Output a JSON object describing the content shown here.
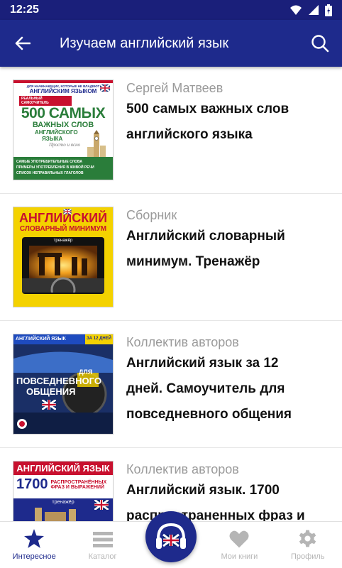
{
  "status_bar": {
    "time": "12:25"
  },
  "app_bar": {
    "title": "Изучаем английский язык"
  },
  "books": [
    {
      "author": "Сергей Матвеев",
      "title_lines": [
        "500 самых важных слов",
        "английского языка"
      ]
    },
    {
      "author": "Сборник",
      "title_lines": [
        "Английский словарный",
        "минимум. Тренажёр"
      ]
    },
    {
      "author": "Коллектив авторов",
      "title_lines": [
        "Английский язык за 12",
        "дней. Самоучитель для",
        "повседневного общения"
      ]
    },
    {
      "author": "Коллектив авторов",
      "title_lines": [
        "Английский язык. 1700",
        "распространенных фраз и"
      ]
    }
  ],
  "covers": {
    "cover1": {
      "top_text": "ДЛЯ НАЧИНАЮЩИХ, КОТОРЫЕ НЕ ВЛАДЕЮТ",
      "brand": "АНГЛИЙСКИМ ЯЗЫКОМ",
      "badge": "РЕАЛЬНЫЙ САМОУЧИТЕЛЬ",
      "big": "500 САМЫХ",
      "sub1": "ВАЖНЫХ СЛОВ",
      "sub2": "АНГЛИЙСКОГО",
      "sub3": "ЯЗЫКА",
      "script": "Просто и ясно",
      "b1": "САМЫЕ УПОТРЕБИТЕЛЬНЫЕ СЛОВА",
      "b2": "ПРИМЕРЫ УПОТРЕБЛЕНИЯ В ЖИВОЙ РЕЧИ",
      "b3": "СПИСОК НЕПРАВИЛЬНЫХ ГЛАГОЛОВ"
    },
    "cover2": {
      "line1": "АНГЛИЙСКИЙ",
      "line2": "СЛОВАРНЫЙ МИНИМУМ",
      "tag": "тренажёр"
    },
    "cover3": {
      "head": "АНГЛИЙСКИЙ ЯЗЫК",
      "days": "ЗА 12 ДНЕЙ",
      "l1": "ДЛЯ",
      "l2": "ПОВСЕДНЕВНОГО",
      "l3": "ОБЩЕНИЯ"
    },
    "cover4": {
      "head": "АНГЛИЙСКИЙ ЯЗЫК",
      "num": "1700",
      "t1": "РАСПРОСТРАНЁННЫХ",
      "t2": "ФРАЗ И ВЫРАЖЕНИЙ",
      "tag": "тренажёр"
    }
  },
  "bottom_nav": [
    {
      "label": "Интересное"
    },
    {
      "label": "Каталог"
    },
    {
      "label": ""
    },
    {
      "label": "Мои книги"
    },
    {
      "label": "Профиль"
    }
  ],
  "colors": {
    "primary": "#1e2a8c",
    "status_bar": "#1a1f7a",
    "inactive": "#b5b5b5",
    "author_gray": "#9a9a9a"
  }
}
